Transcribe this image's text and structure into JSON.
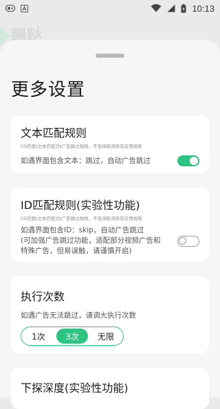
{
  "status_bar": {
    "time": "10:13",
    "left_icons": [
      "app-icon",
      "a-icon"
    ],
    "right_icons": [
      "wifi-icon",
      "signal-icon",
      "battery-icon"
    ]
  },
  "background": {
    "title": "蹦跶"
  },
  "page": {
    "title": "更多设置"
  },
  "cards": {
    "text_rules": {
      "title": "文本匹配规则",
      "subtitle": "[ID匹配|文本匹配]为广告跳过规则，不支持取消所有应用规则",
      "description": "如遇界面包含文本：跳过，自动广告跳过",
      "enabled": true
    },
    "id_rules": {
      "title": "ID匹配规则(实验性功能)",
      "subtitle": "[ID匹配|文本匹配]为广告跳过规则，不支持取消所有应用规则",
      "description_lines": [
        "如遇界面包含ID：skip，自动广告跳过",
        "(可加强广告跳过功能，适配部分视频广告和",
        "特殊广告，但易误触，请谨慎开启)"
      ],
      "enabled": false
    },
    "exec_count": {
      "title": "执行次数",
      "description": "如遇广告无法跳过，请调大执行次数",
      "options": [
        "1次",
        "3次",
        "无限"
      ],
      "selected": "3次"
    },
    "probe_depth": {
      "title": "下探深度(实验性功能)"
    }
  },
  "colors": {
    "accent": "#2bc483",
    "background": "#e9ebea",
    "sheet": "#f5f6f6",
    "card": "#ffffff"
  }
}
